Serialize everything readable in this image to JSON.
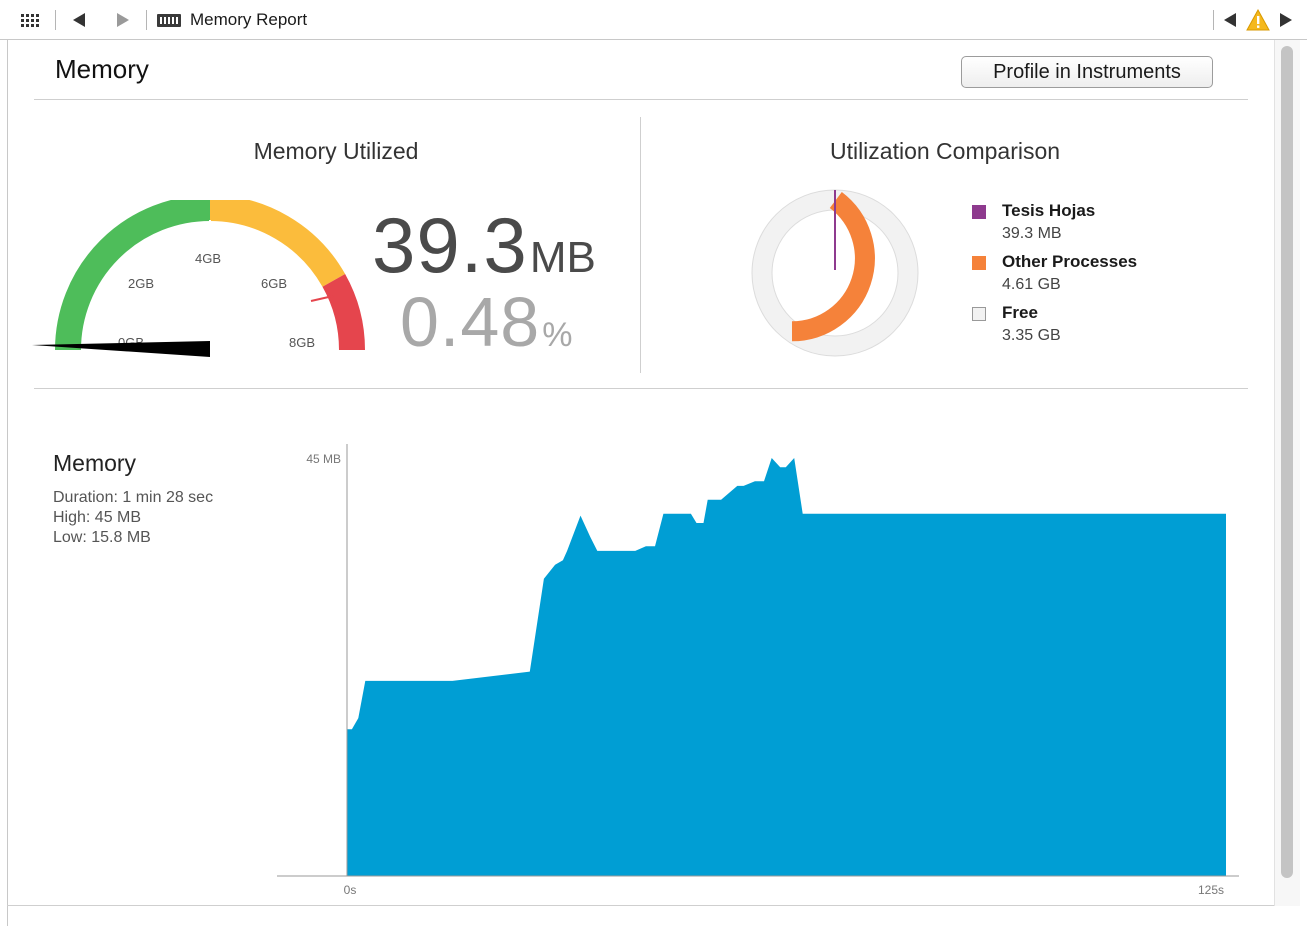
{
  "jumpbar": {
    "title": "Memory Report",
    "icons": [
      "grid-icon",
      "back-arrow-icon",
      "forward-arrow-icon",
      "memory-chip-icon",
      "previous-issue-icon",
      "warning-icon",
      "next-issue-icon"
    ]
  },
  "header": {
    "title": "Memory",
    "profile_button_label": "Profile in Instruments"
  },
  "memory_utilized": {
    "title": "Memory Utilized",
    "value": "39.3",
    "unit": "MB",
    "percent": "0.48",
    "percent_unit": "%",
    "gauge": {
      "ticks": [
        "0GB",
        "2GB",
        "4GB",
        "6GB",
        "8GB"
      ],
      "max_gb": 8,
      "used_fraction": 0.0048,
      "colors": {
        "green": "#4ebd5a",
        "yellow": "#fbbc3c",
        "red": "#e5454d",
        "needle": "#000000"
      }
    }
  },
  "utilization_comparison": {
    "title": "Utilization Comparison",
    "legend": [
      {
        "name": "Tesis Hojas",
        "value": "39.3 MB",
        "color": "#8e3a8e"
      },
      {
        "name": "Other Processes",
        "value": "4.61 GB",
        "color": "#f5823a"
      },
      {
        "name": "Free",
        "value": "3.35 GB",
        "color": "#f2f2f2"
      }
    ]
  },
  "memory_graph": {
    "title": "Memory",
    "duration": "Duration: 1 min 28 sec",
    "high": "High: 45 MB",
    "low": "Low: 15.8 MB",
    "fill_color": "#009ed4"
  },
  "chart_data": {
    "type": "area",
    "title": "",
    "xlabel": "",
    "ylabel": "",
    "x_tick_labels": [
      "0s",
      "125s"
    ],
    "y_tick_labels": [
      "45 MB"
    ],
    "xlim": [
      0,
      125
    ],
    "ylim": [
      0,
      45
    ],
    "series": [
      {
        "x": [
          0,
          0.7,
          1.6,
          2.6,
          5,
          15,
          26,
          28,
          29.6,
          30.7,
          31.3,
          33.2,
          34.6,
          35.6,
          36.6,
          37.6,
          39,
          40,
          41,
          42.5,
          43.8,
          45,
          46.3,
          47.7,
          48.9,
          49.7,
          50.7,
          51.3,
          53.2,
          55.5,
          56.4,
          58,
          59.3,
          60.4,
          61.6,
          62.4,
          63.6,
          64.8,
          66.2,
          67.5,
          69.1,
          70.1,
          71.2,
          72.2,
          73.4,
          74.2,
          75.8,
          76.6,
          77.6,
          78.2,
          78.7,
          79.7,
          80.7,
          82,
          83.2,
          84.6,
          86.1,
          87.5,
          88.2,
          89.2,
          90.4,
          91.6,
          92,
          93.4,
          94.6,
          95.6,
          96.4,
          97.4,
          98.4,
          99.2,
          100.6,
          101.2,
          102.4,
          103.4,
          104.6,
          105.5,
          106.9,
          108.1,
          109.3,
          110.9,
          111.3,
          112.4,
          113.4,
          114.4,
          115.2,
          116.3,
          117.2,
          118.3,
          118.9,
          120,
          121.4,
          122.9,
          124.2,
          125
        ],
        "y": [
          15.8,
          15.8,
          17,
          21,
          21,
          21,
          22,
          32,
          33.5,
          34,
          35,
          38.8,
          36.5,
          35,
          35,
          35,
          35,
          35,
          35,
          35.5,
          35.5,
          39,
          39,
          39,
          39,
          38,
          38,
          40.5,
          40.5,
          42,
          42,
          42.5,
          42.5,
          45,
          44,
          44,
          45,
          39,
          39,
          39,
          39,
          39,
          39,
          39,
          39,
          39,
          39,
          39,
          39,
          39,
          39,
          39,
          39,
          39,
          39,
          39,
          39,
          39,
          39,
          39,
          39,
          39,
          39,
          39,
          39,
          39,
          39,
          39,
          39,
          39,
          39,
          39,
          39,
          39,
          39,
          39,
          39,
          39,
          39,
          39,
          39,
          39,
          39,
          39,
          39,
          39,
          39,
          39,
          39,
          39,
          39,
          39,
          39,
          39
        ]
      }
    ]
  }
}
